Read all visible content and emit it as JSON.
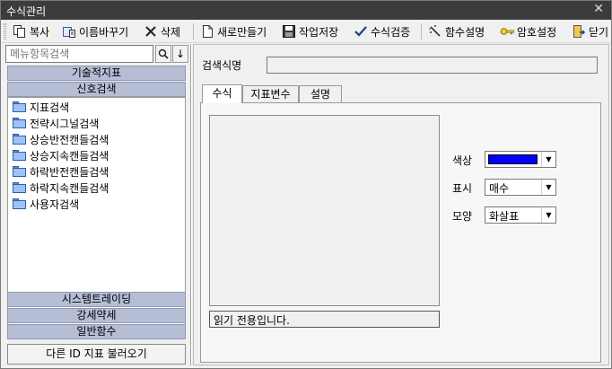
{
  "window": {
    "title": "수식관리",
    "close_glyph": "✕"
  },
  "toolbar": {
    "copy": "복사",
    "rename": "이름바꾸기",
    "delete": "삭제",
    "new": "새로만들기",
    "save": "작업저장",
    "verify": "수식검증",
    "func_help": "함수설명",
    "password": "암호설정",
    "close": "닫기"
  },
  "left": {
    "search_placeholder": "메뉴항목검색",
    "search_btn_glyph": "🔍",
    "down_btn_glyph": "↓",
    "top_categories": [
      "기술적지표",
      "신호검색"
    ],
    "tree_items": [
      "지표검색",
      "전략시그널검색",
      "상승반전캔들검색",
      "상승지속캔들검색",
      "하락반전캔들검색",
      "하락지속캔들검색",
      "사용자검색"
    ],
    "bottom_categories": [
      "시스템트레이딩",
      "강세약세",
      "일반함수"
    ],
    "load_button": "다른 ID 지표 불러오기"
  },
  "right": {
    "search_name_label": "검색식명",
    "search_name_value": "",
    "tabs": [
      "수식",
      "지표변수",
      "설명"
    ],
    "active_tab": "수식",
    "status_text": "읽기 전용입니다.",
    "color_label": "색상",
    "color_value": "#0000ff",
    "display_label": "표시",
    "display_value": "매수",
    "shape_label": "모양",
    "shape_value": "화살표"
  }
}
